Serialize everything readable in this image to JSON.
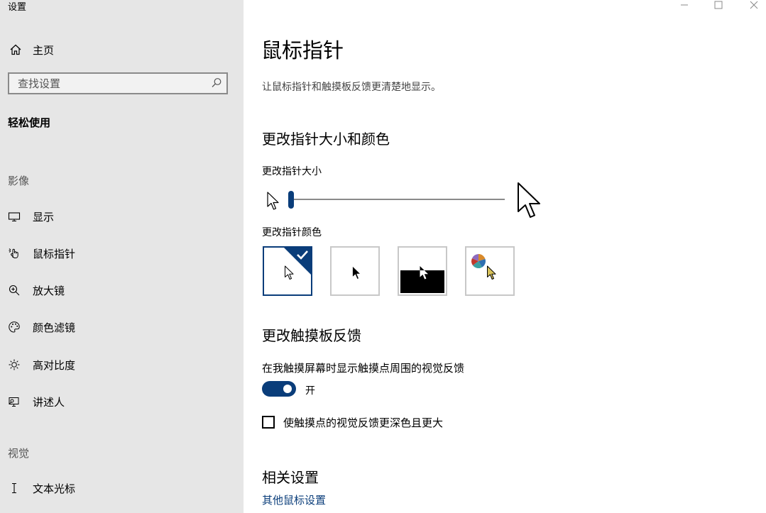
{
  "window": {
    "title": "设置"
  },
  "sidebar": {
    "home": {
      "label": "主页",
      "icon": "home-icon"
    },
    "search": {
      "placeholder": "查找设置",
      "icon": "search-icon"
    },
    "category": "轻松使用",
    "groups": [
      {
        "header": "影像",
        "items": [
          {
            "label": "显示",
            "icon": "monitor-icon"
          },
          {
            "label": "鼠标指针",
            "icon": "mouse-pointer-hand-icon",
            "active": true
          },
          {
            "label": "放大镜",
            "icon": "magnifier-icon"
          },
          {
            "label": "颜色滤镜",
            "icon": "palette-icon"
          },
          {
            "label": "高对比度",
            "icon": "sun-icon"
          },
          {
            "label": "讲述人",
            "icon": "narrator-icon"
          }
        ]
      },
      {
        "header": "视觉",
        "items": [
          {
            "label": "文本光标",
            "icon": "text-cursor-icon"
          }
        ]
      }
    ]
  },
  "window_controls": [
    "minimize-icon",
    "maximize-icon",
    "close-icon"
  ],
  "main": {
    "title": "鼠标指针",
    "description": "让鼠标指针和触摸板反馈更清楚地显示。",
    "size_color_section": {
      "heading": "更改指针大小和颜色",
      "size_label": "更改指针大小",
      "size_slider_value": 1,
      "color_label": "更改指针颜色",
      "color_options": [
        {
          "name": "white",
          "selected": true
        },
        {
          "name": "black",
          "selected": false
        },
        {
          "name": "inverted",
          "selected": false
        },
        {
          "name": "custom",
          "selected": false
        }
      ]
    },
    "touch_section": {
      "heading": "更改触摸板反馈",
      "toggle_label": "在我触摸屏幕时显示触摸点周围的视觉反馈",
      "toggle_on": true,
      "toggle_state": "开",
      "checkbox_label": "使触摸点的视觉反馈更深色且更大",
      "checkbox_checked": false
    },
    "related": {
      "heading": "相关设置",
      "link": "其他鼠标设置"
    }
  },
  "colors": {
    "accent": "#0a3d7a",
    "sidebar_bg": "#e6e6e6"
  }
}
